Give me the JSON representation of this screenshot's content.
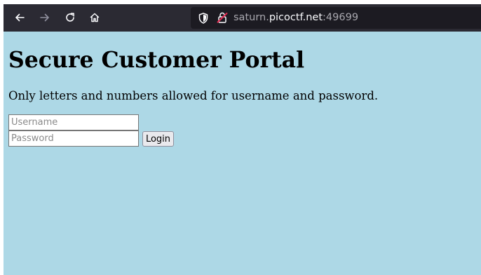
{
  "browser": {
    "url_subdomain": "saturn.",
    "url_host": "picoctf.net",
    "url_port": ":49699",
    "icons": {
      "back": "back-arrow-icon",
      "forward": "forward-arrow-icon",
      "reload": "reload-icon",
      "home": "home-icon",
      "shield": "shield-icon",
      "lock": "lock-insecure-icon"
    }
  },
  "page": {
    "title": "Secure Customer Portal",
    "instructions": "Only letters and numbers allowed for username and password.",
    "background_color": "#add8e6"
  },
  "form": {
    "username_placeholder": "Username",
    "username_value": "",
    "password_placeholder": "Password",
    "password_value": "",
    "login_label": "Login"
  }
}
